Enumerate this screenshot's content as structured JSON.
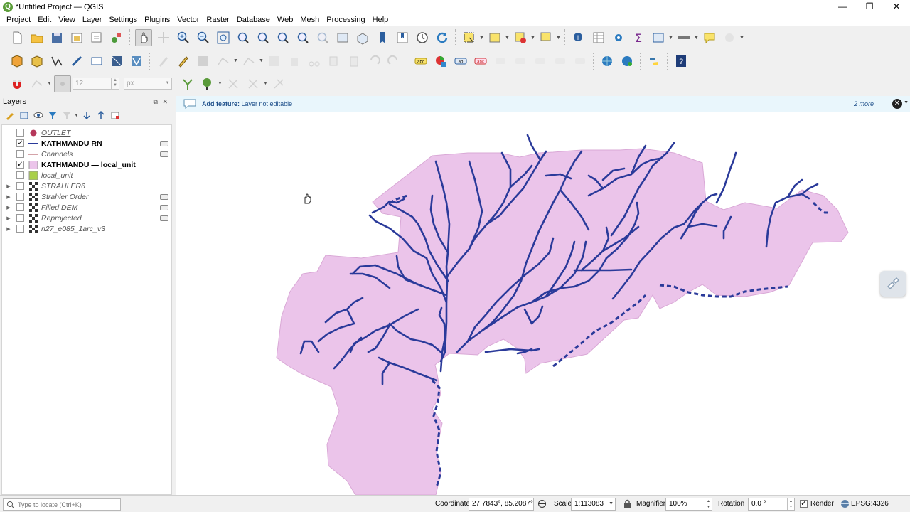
{
  "window": {
    "title": "*Untitled Project — QGIS",
    "controls": [
      "—",
      "❐",
      "✕"
    ]
  },
  "menu": [
    "Project",
    "Edit",
    "View",
    "Layer",
    "Settings",
    "Plugins",
    "Vector",
    "Raster",
    "Database",
    "Web",
    "Mesh",
    "Processing",
    "Help"
  ],
  "digitizing": {
    "snap_tolerance": "12",
    "snap_unit": "px"
  },
  "layers_panel": {
    "title": "Layers",
    "header_controls": "⧉ ✕",
    "layers": [
      {
        "name": "OUTLET",
        "checked": false,
        "symbol": "point",
        "color": "#b5375a",
        "expandable": false,
        "indicator": false
      },
      {
        "name": "KATHMANDU RN",
        "checked": true,
        "symbol": "line",
        "color": "#2a3a9a",
        "expandable": false,
        "indicator": true
      },
      {
        "name": "Channels",
        "checked": false,
        "symbol": "line",
        "color": "#d4a3a8",
        "expandable": false,
        "indicator": true
      },
      {
        "name": "KATHMANDU — local_unit",
        "checked": true,
        "symbol": "fill",
        "color": "#ebc4ea",
        "expandable": false,
        "indicator": false
      },
      {
        "name": "local_unit",
        "checked": false,
        "symbol": "fill",
        "color": "#a9cf4a",
        "expandable": false,
        "indicator": false
      },
      {
        "name": "STRAHLER6",
        "checked": false,
        "symbol": "raster",
        "color": "#333333",
        "expandable": true,
        "indicator": false
      },
      {
        "name": "Strahler Order",
        "checked": false,
        "symbol": "raster",
        "color": "#333333",
        "expandable": true,
        "indicator": true
      },
      {
        "name": "Filled DEM",
        "checked": false,
        "symbol": "raster",
        "color": "#333333",
        "expandable": true,
        "indicator": true
      },
      {
        "name": "Reprojected",
        "checked": false,
        "symbol": "raster",
        "color": "#333333",
        "expandable": true,
        "indicator": true
      },
      {
        "name": "n27_e085_1arc_v3",
        "checked": false,
        "symbol": "raster",
        "color": "#333333",
        "expandable": true,
        "indicator": false
      }
    ]
  },
  "message_bar": {
    "label": "Add feature:",
    "text": "Layer not editable",
    "more": "2 more"
  },
  "map": {
    "catchment_fill": "#ebc4ea",
    "catchment_stroke": "#d9a8d6",
    "river_color": "#2a3a9a",
    "background": "#ffffff"
  },
  "status_bar": {
    "locator_placeholder": "Type to locate (Ctrl+K)",
    "coordinate_label": "Coordinate",
    "coordinate_value": "27.7843°, 85.2087°",
    "scale_label": "Scale",
    "scale_value": "1:113083",
    "magnifier_label": "Magnifier",
    "magnifier_value": "100%",
    "rotation_label": "Rotation",
    "rotation_value": "0.0 °",
    "render_label": "Render",
    "render_checked": true,
    "crs": "EPSG:4326"
  }
}
